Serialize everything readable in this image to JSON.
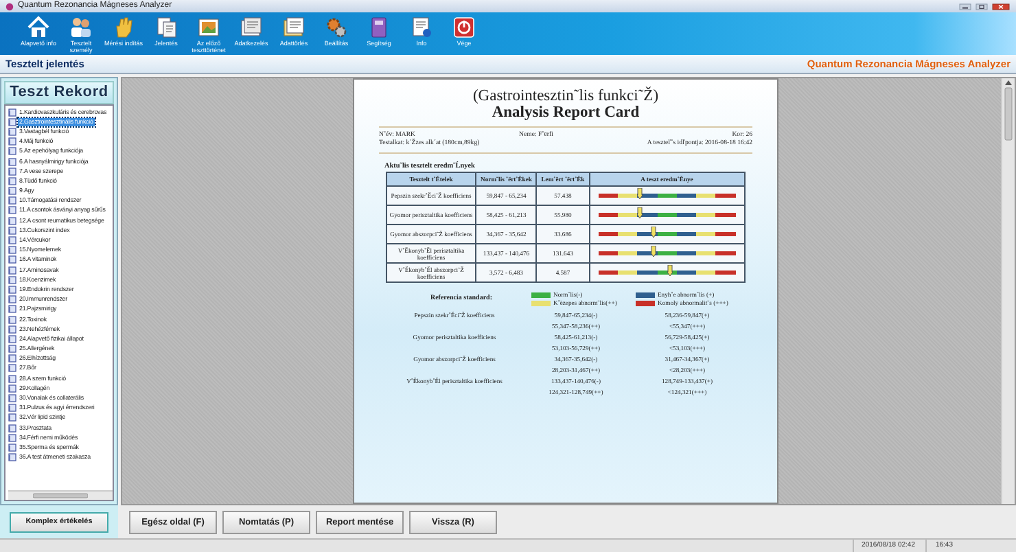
{
  "window": {
    "title": "Quantum Rezonancia Mágneses Analyzer"
  },
  "toolbar": [
    {
      "label": "Alapvető info"
    },
    {
      "label": "Tesztelt személy"
    },
    {
      "label": "Mérési indítás"
    },
    {
      "label": "Jelentés"
    },
    {
      "label": "Az előző teszttörténet"
    },
    {
      "label": "Adatkezelés"
    },
    {
      "label": "Adattörlés"
    },
    {
      "label": "Beállítás"
    },
    {
      "label": "Segítség"
    },
    {
      "label": "Info"
    },
    {
      "label": "Vége"
    }
  ],
  "header": {
    "title": "Tesztelt jelentés",
    "brand": "Quantum Rezonancia Mágneses Analyzer"
  },
  "sidebar": {
    "title": "Teszt Rekord",
    "items": [
      {
        "label": "1.Kardiovaszkuláris és cerebrovas",
        "selected": false
      },
      {
        "label": "2.Gasztrointesztinális funkció",
        "selected": true
      },
      {
        "label": "3.Vastagbél funkció",
        "selected": false
      },
      {
        "label": "4.Máj funkció",
        "selected": false
      },
      {
        "label": "5.Az epehólyag funkciója",
        "selected": false
      },
      {
        "label": "6.A hasnyálmirigy funkciója",
        "selected": false
      },
      {
        "label": "7.A vese szerepe",
        "selected": false
      },
      {
        "label": "8.Tüdő funkció",
        "selected": false
      },
      {
        "label": "9.Agy",
        "selected": false
      },
      {
        "label": "10.Támogatási rendszer",
        "selected": false
      },
      {
        "label": "11.A csontok ásványi anyag sűrűs",
        "selected": false
      },
      {
        "label": "12.A csont reumatikus betegsége",
        "selected": false
      },
      {
        "label": "13.Cukorszint index",
        "selected": false
      },
      {
        "label": "14.Vércukor",
        "selected": false
      },
      {
        "label": "15.Nyomelemek",
        "selected": false
      },
      {
        "label": "16.A vitaminok",
        "selected": false
      },
      {
        "label": "17.Aminosavak",
        "selected": false
      },
      {
        "label": "18.Koenzimek",
        "selected": false
      },
      {
        "label": "19.Endokrin rendszer",
        "selected": false
      },
      {
        "label": "20.Immunrendszer",
        "selected": false
      },
      {
        "label": "21.Pajzsmirigy",
        "selected": false
      },
      {
        "label": "22.Toxinok",
        "selected": false
      },
      {
        "label": "23.Nehézfémek",
        "selected": false
      },
      {
        "label": "24.Alapvető fizikai állapot",
        "selected": false
      },
      {
        "label": "25.Allergének",
        "selected": false
      },
      {
        "label": "26.Elhízottság",
        "selected": false
      },
      {
        "label": "27.Bőr",
        "selected": false
      },
      {
        "label": "28.A szem funkció",
        "selected": false
      },
      {
        "label": "29.Kollagén",
        "selected": false
      },
      {
        "label": "30.Vonalak és collaterális",
        "selected": false
      },
      {
        "label": "31.Pulzus és agyi érrendszeri",
        "selected": false
      },
      {
        "label": "32.Vér lipid szintje",
        "selected": false
      },
      {
        "label": "33.Prosztata",
        "selected": false
      },
      {
        "label": "34.Férfi nemi működés",
        "selected": false
      },
      {
        "label": "35.Sperma és spermák",
        "selected": false
      },
      {
        "label": "36.A test átmeneti szakasza",
        "selected": false
      }
    ],
    "button": "Komplex értékelés"
  },
  "report": {
    "title": "(Gastrointesztin˜lis funkci˜Ž)",
    "subtitle": "Analysis Report Card",
    "info": {
      "name": "N˚év: MARK",
      "sex": "Neme: F˚ërfi",
      "age": "Kor: 26",
      "build": "Testalkat: k´Žzes alk´at (180cm,89kg)",
      "time": "A teszteľ˚s idľpontja: 2016-08-18 16:42"
    },
    "section": "Aktu˜lis tesztelt eredm˜Ĺnyek",
    "columns": [
      "Tesztelt t˚Ětelek",
      "Norm˜lis ˚ërt˚Ěkek",
      "Lem˚ërt ˚ërt˚Ěk",
      "A teszt eredm˚Ěnye"
    ],
    "rows": [
      {
        "item": "Pepszin szekr˚Ěci˜Ž koefficiens",
        "normal": "59,847 - 65,234",
        "value": "57.438",
        "level": 0.3
      },
      {
        "item": "Gyomor perisztaltika koefficiens",
        "normal": "58,425 - 61,213",
        "value": "55.980",
        "level": 0.3
      },
      {
        "item": "Gyomor abszorpci˜Ž koefficiens",
        "normal": "34,367 - 35,642",
        "value": "33.686",
        "level": 0.4
      },
      {
        "item": "V˚Ěkonyb˚Ěl perisztaltika koefficiens",
        "normal": "133,437 - 140,476",
        "value": "131.643",
        "level": 0.4
      },
      {
        "item": "V˚Ěkonyb˚Ěl abszorpci˜Ž koefficiens",
        "normal": "3,572 - 6,483",
        "value": "4.587",
        "level": 0.52
      }
    ],
    "legend_title": "Referencia standard:",
    "legend": [
      {
        "label": "Norm˜lis(-)",
        "color": "#3cb043"
      },
      {
        "label": "Enyh˚e abnorm˜lis (+)",
        "color": "#2f5f8f"
      },
      {
        "label": "K˚ëzepes abnorm˜lis(++)",
        "color": "#e8e070"
      },
      {
        "label": "Komoly abnormalit˜s (+++)",
        "color": "#c83028"
      }
    ],
    "reference": [
      {
        "item": "Pepszin szekr˚Ěci˜Ž koefficiens",
        "ranges": [
          "59,847-65,234(-)",
          "58,236-59,847(+)",
          "55,347-58,236(++)",
          "<55,347(+++)"
        ]
      },
      {
        "item": "Gyomor perisztaltika koefficiens",
        "ranges": [
          "58,425-61,213(-)",
          "56,729-58,425(+)",
          "53,103-56,729(++)",
          "<53,103(+++)"
        ]
      },
      {
        "item": "Gyomor abszorpci˜Ž koefficiens",
        "ranges": [
          "34,367-35,642(-)",
          "31,467-34,367(+)",
          "28,203-31,467(++)",
          "<28,203(+++)"
        ]
      },
      {
        "item": "V˚Ěkonyb˚Ěl perisztaltika koefficiens",
        "ranges": [
          "133,437-140,476(-)",
          "128,749-133,437(+)",
          "124,321-128,749(++)",
          "<124,321(+++)"
        ]
      }
    ]
  },
  "buttons": [
    {
      "label": "Egész oldal (F)"
    },
    {
      "label": "Nomtatás (P)"
    },
    {
      "label": "Report mentése"
    },
    {
      "label": "Vissza (R)"
    }
  ],
  "status_bar": [
    "2016/08/18 02:42",
    "16:43"
  ]
}
